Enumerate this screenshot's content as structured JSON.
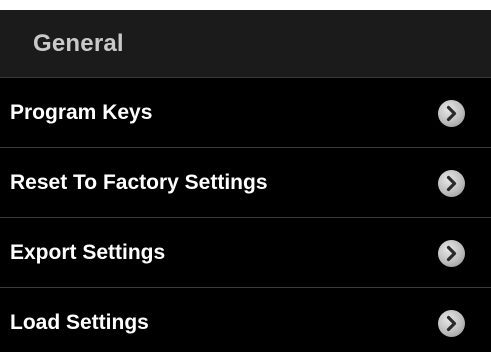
{
  "header": {
    "title": "General"
  },
  "settings": {
    "items": [
      {
        "label": "Program Keys",
        "icon": "chevron-right-icon"
      },
      {
        "label": "Reset To Factory Settings",
        "icon": "chevron-right-icon"
      },
      {
        "label": "Export Settings",
        "icon": "chevron-right-icon"
      },
      {
        "label": "Load Settings",
        "icon": "chevron-right-icon"
      }
    ]
  },
  "colors": {
    "background": "#000000",
    "header_background": "#1b1b1b",
    "header_text": "#c9c9c9",
    "item_text": "#ffffff",
    "divider": "#3b3b3b",
    "chevron_circle": "#bdbdbd",
    "chevron_arrow": "#2a2a2a"
  }
}
